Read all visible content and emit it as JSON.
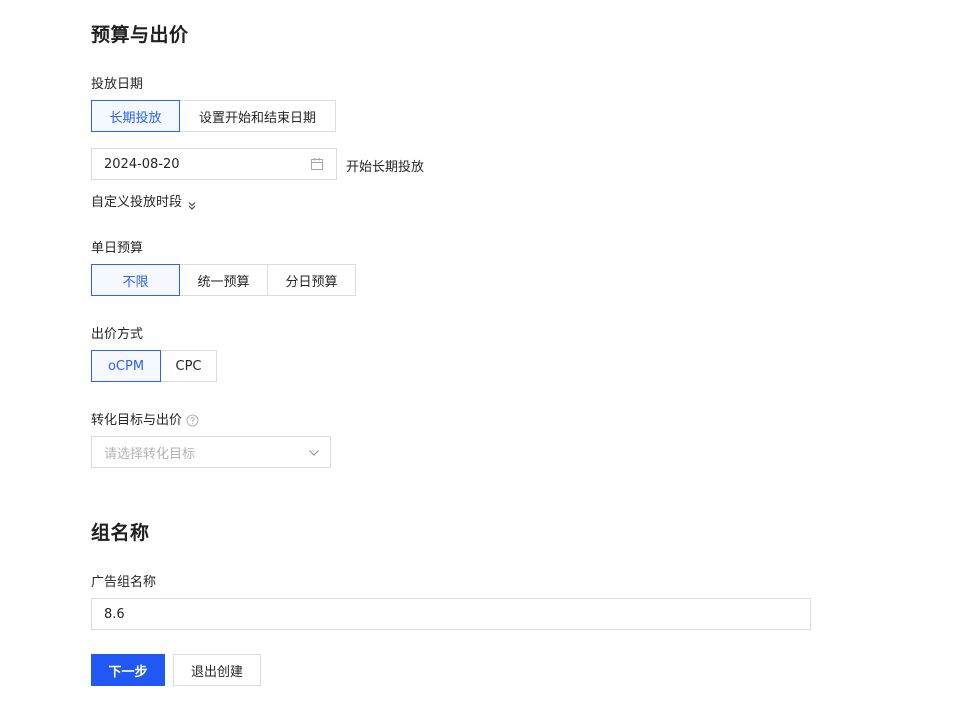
{
  "budget_section": {
    "title": "预算与出价",
    "schedule": {
      "label": "投放日期",
      "options": [
        "长期投放",
        "设置开始和结束日期"
      ],
      "selected": "长期投放",
      "date_value": "2024-08-20",
      "date_hint": "开始长期投放",
      "custom_time_link": "自定义投放时段"
    },
    "daily_budget": {
      "label": "单日预算",
      "options": [
        "不限",
        "统一预算",
        "分日预算"
      ],
      "selected": "不限"
    },
    "bid_method": {
      "label": "出价方式",
      "options": [
        "oCPM",
        "CPC"
      ],
      "selected": "oCPM"
    },
    "conversion": {
      "label": "转化目标与出价",
      "placeholder": "请选择转化目标"
    }
  },
  "group_section": {
    "title": "组名称",
    "name_label": "广告组名称",
    "name_value": "8.6"
  },
  "actions": {
    "next_label": "下一步",
    "exit_label": "退出创建"
  },
  "colors": {
    "accent": "#2962ff",
    "primary_button": "#2157f2",
    "border": "#dcdcdc"
  },
  "icons": {
    "date": "calendar-icon",
    "expand": "double-chevron-down-icon",
    "help": "help-circle-icon",
    "dropdown": "chevron-down-icon"
  }
}
